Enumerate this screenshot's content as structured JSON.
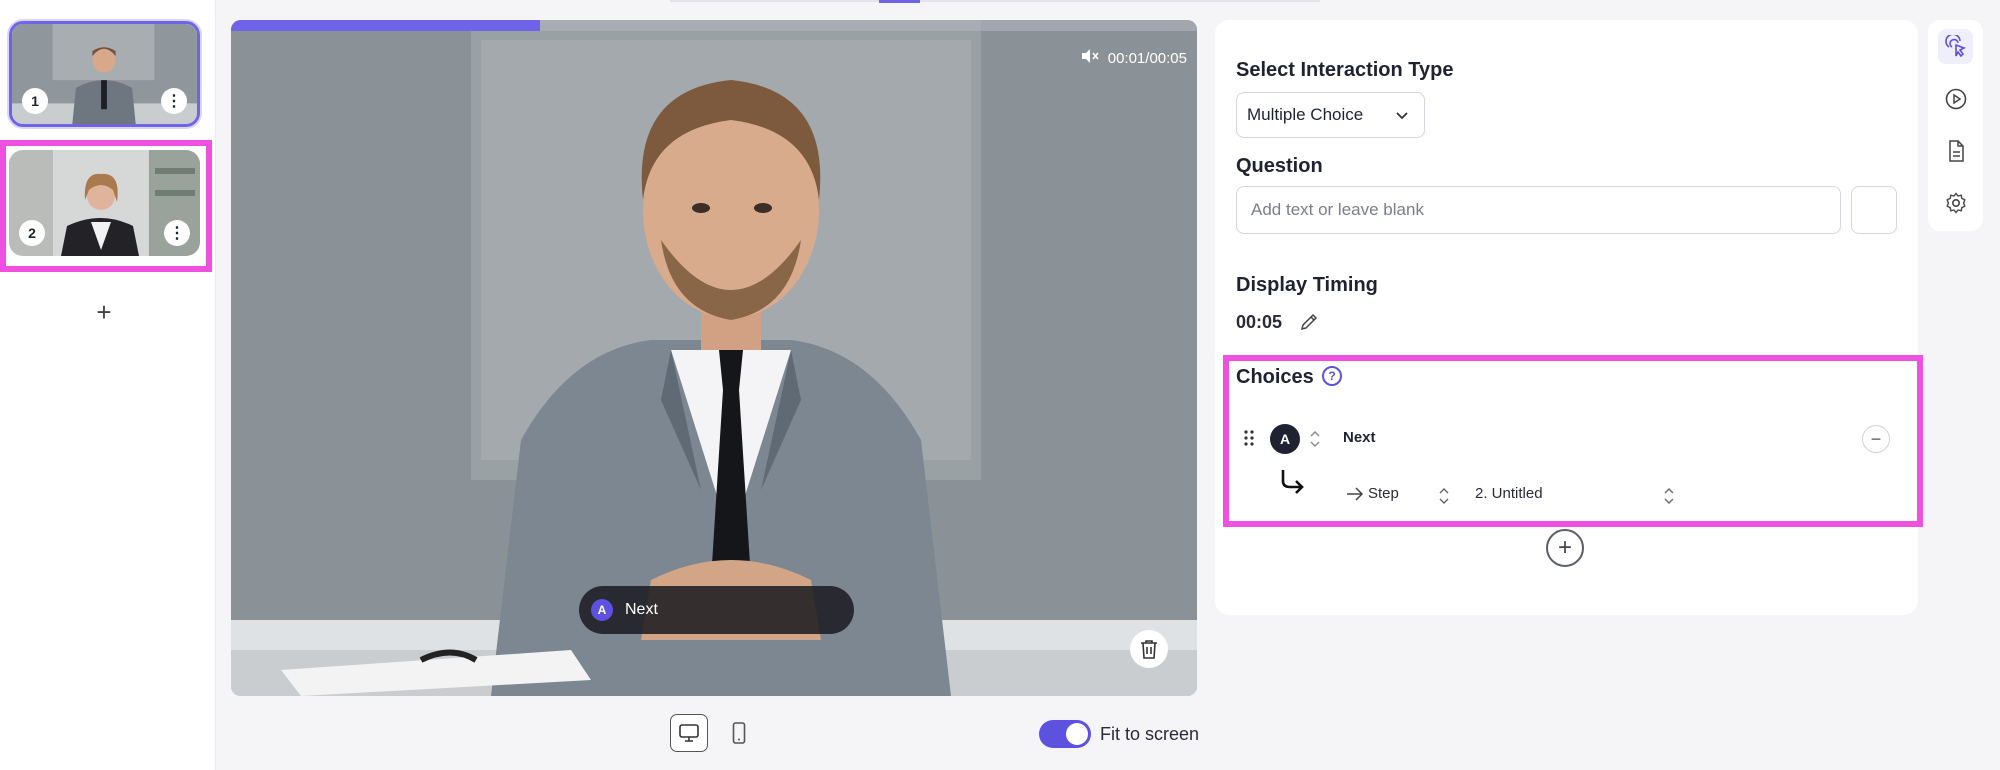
{
  "colors": {
    "accent": "#6f63e8",
    "highlight": "#f050e0",
    "dark": "#1f2233"
  },
  "sidebar": {
    "steps": [
      {
        "number": "1",
        "selected": true
      },
      {
        "number": "2",
        "selected": false
      }
    ],
    "add_icon": "plus-icon"
  },
  "video": {
    "progress_fraction": 0.32,
    "current_time": "00:01",
    "separator": "/",
    "duration": "00:05",
    "muted": true,
    "overlay_choice": {
      "letter": "A",
      "label": "Next"
    }
  },
  "toolbar": {
    "fit_label": "Fit to screen",
    "fit_enabled": true
  },
  "panel": {
    "interaction_type_label": "Select Interaction Type",
    "interaction_type_value": "Multiple Choice",
    "question_label": "Question",
    "question_placeholder": "Add text or leave blank",
    "question_value": "",
    "timing_label": "Display Timing",
    "timing_value": "00:05",
    "choices_label": "Choices",
    "choices": [
      {
        "letter": "A",
        "text": "Next",
        "action": "Step",
        "target": "2. Untitled"
      }
    ]
  },
  "rail": {
    "icons": [
      "interaction-icon",
      "play-icon",
      "document-icon",
      "settings-icon"
    ],
    "active": "interaction-icon"
  }
}
